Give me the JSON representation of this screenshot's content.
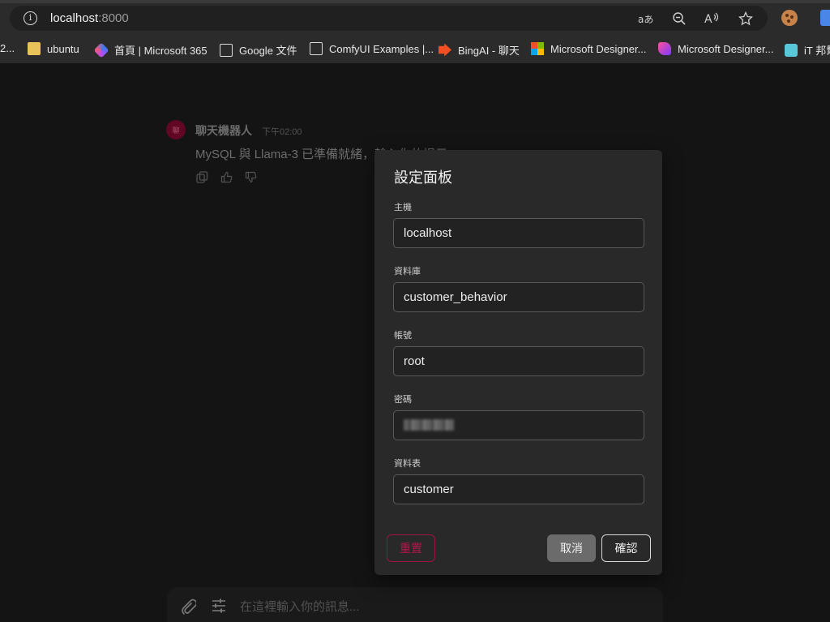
{
  "browser": {
    "url_host": "localhost",
    "url_port": ":8000",
    "bookmarks": [
      {
        "label": "2...",
        "icon": "folder-icon"
      },
      {
        "label": "ubuntu",
        "icon": "folder-icon"
      },
      {
        "label": "首頁 | Microsoft 365",
        "icon": "microsoft-365-icon"
      },
      {
        "label": "Google 文件",
        "icon": "page-icon"
      },
      {
        "label": "ComfyUI Examples |...",
        "icon": "page-icon"
      },
      {
        "label": "BingAI - 聊天",
        "icon": "bing-icon"
      },
      {
        "label": "Microsoft Designer...",
        "icon": "microsoft-icon"
      },
      {
        "label": "Microsoft Designer...",
        "icon": "designer-icon"
      },
      {
        "label": "iT 邦幫",
        "icon": "ithome-icon"
      }
    ],
    "toolbar_icons": [
      "translate-icon",
      "zoom-out-icon",
      "read-aloud-icon",
      "favorite-star-icon",
      "cookie-extension-icon"
    ]
  },
  "chat": {
    "sender": "聊天機器人",
    "timestamp": "下午02:00",
    "message": "MySQL 與 Llama-3 已準備就緒，輸入你的提示",
    "avatar_text": "聊",
    "composer_placeholder": "在這裡輸入你的訊息..."
  },
  "dialog": {
    "title": "設定面板",
    "fields": {
      "host": {
        "label": "主機",
        "value": "localhost"
      },
      "database": {
        "label": "資料庫",
        "value": "customer_behavior"
      },
      "account": {
        "label": "帳號",
        "value": "root"
      },
      "password": {
        "label": "密碼",
        "value": ""
      },
      "table": {
        "label": "資料表",
        "value": "customer"
      }
    },
    "reset_label": "重置",
    "cancel_label": "取消",
    "confirm_label": "確認"
  },
  "colors": {
    "background": "#1a1a1a",
    "dialog_bg": "#292929",
    "accent_reset": "#b8154a",
    "avatar": "#7a0a2e"
  }
}
